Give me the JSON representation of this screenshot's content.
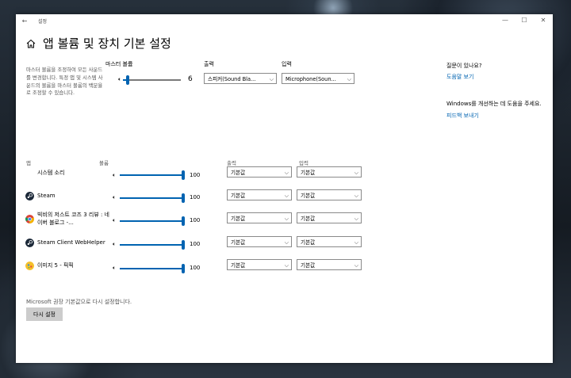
{
  "window": {
    "title": "설정"
  },
  "header": {
    "title": "앱 볼륨 및 장치 기본 설정"
  },
  "master": {
    "description": "마스터 볼륨을 조정하여 모든 사운드를 변경합니다. 특정 앱 및 시스템 사운드의 볼륨을 마스터 볼륨의 백분율로 조정할 수 있습니다.",
    "volume_label": "마스터 볼륨",
    "volume_value": "6",
    "volume_level": 0.06,
    "output_label": "출력",
    "output_value": "스피커(Sound Bla...",
    "input_label": "입력",
    "input_value": "Microphone(Soun..."
  },
  "sidebar": {
    "question": "질문이 있나요?",
    "help_link": "도움말 보기",
    "improve": "Windows를 개선하는 데 도움을 주세요.",
    "feedback_link": "피드백 보내기"
  },
  "table": {
    "col_app": "앱",
    "col_volume": "볼륨",
    "col_output": "출력",
    "col_input": "입력",
    "rows": [
      {
        "name": "시스템 소리",
        "volume": "100",
        "level": 1.0,
        "output": "기본값",
        "input": "기본값"
      },
      {
        "name": "Steam",
        "volume": "100",
        "level": 1.0,
        "output": "기본값",
        "input": "기본값"
      },
      {
        "name": "빅비의 저스트 코즈 3 리뷰 : 네이버 블로그 -...",
        "volume": "100",
        "level": 1.0,
        "output": "기본값",
        "input": "기본값"
      },
      {
        "name": "Steam Client WebHelper",
        "volume": "100",
        "level": 1.0,
        "output": "기본값",
        "input": "기본값"
      },
      {
        "name": "이미지 5 - 픽픽",
        "volume": "100",
        "level": 1.0,
        "output": "기본값",
        "input": "기본값"
      }
    ]
  },
  "footer": {
    "reset_text": "Microsoft 권장 기본값으로 다시 설정합니다.",
    "reset_button": "다시 설정"
  },
  "colors": {
    "accent": "#0063b1",
    "link": "#0063b1"
  }
}
